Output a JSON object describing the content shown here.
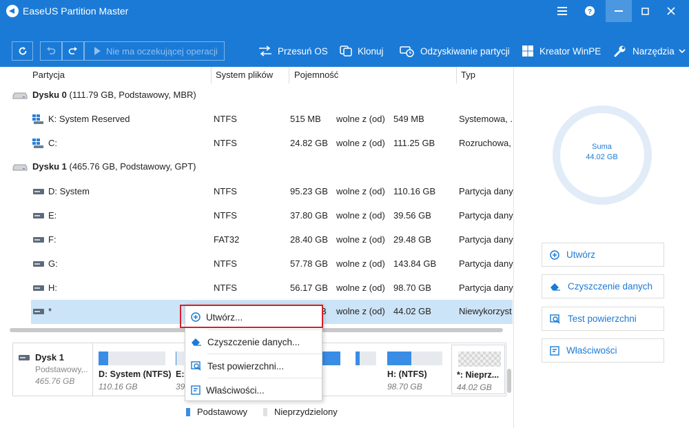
{
  "window": {
    "title": "EaseUS Partition Master",
    "controls": [
      "menu-icon",
      "help-icon",
      "minimize-icon",
      "maximize-icon",
      "close-icon"
    ]
  },
  "toolbar": {
    "pending_label": "Nie ma oczekującej operacji",
    "tools": [
      {
        "label": "Przesuń OS",
        "icon": "migrate-os-icon"
      },
      {
        "label": "Klonuj",
        "icon": "clone-icon"
      },
      {
        "label": "Odzyskiwanie partycji",
        "icon": "partition-recovery-icon"
      },
      {
        "label": "Kreator WinPE",
        "icon": "windows-icon"
      },
      {
        "label": "Narzędzia",
        "icon": "wrench-icon"
      }
    ]
  },
  "table": {
    "columns": [
      "Partycja",
      "System plików",
      "Pojemność",
      "Typ"
    ],
    "disks": [
      {
        "title": "Dysku 0",
        "detail": "(111.79 GB, Podstawowy, MBR)",
        "partitions": [
          {
            "name": "K: System Reserved",
            "fs": "NTFS",
            "free": "515 MB",
            "of": "wolne z (od)",
            "total": "549 MB",
            "type": "Systemowa, ."
          },
          {
            "name": "C:",
            "fs": "NTFS",
            "free": "24.82 GB",
            "of": "wolne z (od)",
            "total": "111.25 GB",
            "type": "Rozruchowa,"
          }
        ]
      },
      {
        "title": "Dysku 1",
        "detail": "(465.76 GB, Podstawowy, GPT)",
        "partitions": [
          {
            "name": "D: System",
            "fs": "NTFS",
            "free": "95.23 GB",
            "of": "wolne z (od)",
            "total": "110.16 GB",
            "type": "Partycja dany"
          },
          {
            "name": "E:",
            "fs": "NTFS",
            "free": "37.80 GB",
            "of": "wolne z (od)",
            "total": "39.56 GB",
            "type": "Partycja dany"
          },
          {
            "name": "F:",
            "fs": "FAT32",
            "free": "28.40 GB",
            "of": "wolne z (od)",
            "total": "29.48 GB",
            "type": "Partycja dany"
          },
          {
            "name": "G:",
            "fs": "NTFS",
            "free": "57.78 GB",
            "of": "wolne z (od)",
            "total": "143.84 GB",
            "type": "Partycja dany"
          },
          {
            "name": "H:",
            "fs": "NTFS",
            "free": "56.17 GB",
            "of": "wolne z (od)",
            "total": "98.70 GB",
            "type": "Partycja dany"
          },
          {
            "name": "*",
            "fs": "",
            "free": "GB",
            "of": "wolne z (od)",
            "total": "44.02 GB",
            "type": "Niewykorzyst",
            "selected": true
          }
        ]
      }
    ]
  },
  "disk_map": {
    "name": "Dysk 1",
    "type": "Podstawowy,..",
    "size": "465.76 GB",
    "partitions": [
      {
        "label": "D: System (NTFS)",
        "size": "110.16 GB",
        "used_fraction": 0.14
      },
      {
        "label": "E:",
        "size": "39",
        "used_fraction": 0.06
      },
      {
        "label": "",
        "size": "",
        "used_fraction": 0.55
      },
      {
        "label": "",
        "size": "",
        "used_fraction": 0.2
      },
      {
        "label": "H: (NTFS)",
        "size": "98.70 GB",
        "used_fraction": 0.44
      },
      {
        "label": "*: Nieprz...",
        "size": "44.02 GB",
        "unallocated": true
      }
    ]
  },
  "legend": {
    "primary": "Podstawowy",
    "unallocated": "Nieprzydzielony",
    "primary_color": "#3a8de6",
    "unallocated_color": "#e0e0e0"
  },
  "summary": {
    "label": "Suma",
    "value": "44.02 GB"
  },
  "side_actions": [
    {
      "label": "Utwórz",
      "icon": "plus-circle-icon"
    },
    {
      "label": "Czyszczenie danych",
      "icon": "eraser-icon"
    },
    {
      "label": "Test powierzchni",
      "icon": "surface-test-icon"
    },
    {
      "label": "Właściwości",
      "icon": "properties-icon"
    }
  ],
  "context_menu": {
    "items": [
      {
        "label": "Utwórz...",
        "icon": "plus-circle-icon",
        "highlighted": true
      },
      {
        "label": "Czyszczenie danych...",
        "icon": "eraser-icon"
      },
      {
        "label": "Test powierzchni...",
        "icon": "surface-test-icon"
      },
      {
        "label": "Właściwości...",
        "icon": "properties-icon"
      }
    ]
  },
  "colors": {
    "accent": "#1b7ad6",
    "selection": "#cce4f7",
    "highlight_border": "#d61f2c"
  }
}
